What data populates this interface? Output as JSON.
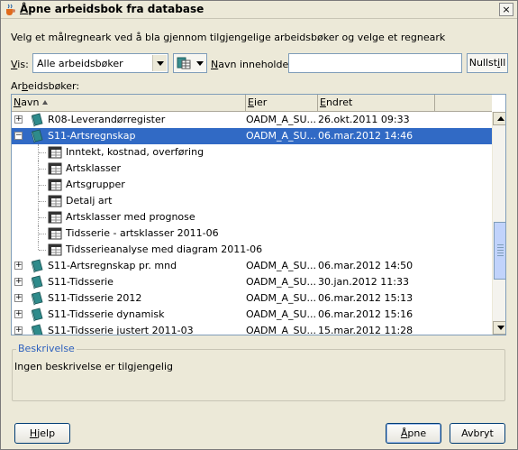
{
  "window": {
    "title_prefix": "Å",
    "title_rest": "pne arbeidsbok fra database",
    "close_label": "×"
  },
  "instruction": "Velg et målregneark ved å bla gjennom tilgjengelige arbeidsbøker og velge et regneark",
  "filter": {
    "vis_prefix": "V",
    "vis_rest": "is:",
    "vis_value": "Alle arbeidsbøker",
    "name_prefix": "N",
    "name_rest": "avn inneholder:",
    "name_value": "",
    "reset_a": "Nullst",
    "reset_u": "i",
    "reset_b": "ll"
  },
  "workbooks_label_a": "Ar",
  "workbooks_label_u": "b",
  "workbooks_label_b": "eidsbøker:",
  "columns": {
    "name_prefix": "N",
    "name_rest": "avn",
    "owner_prefix": "E",
    "owner_rest": "ier",
    "changed_prefix": "E",
    "changed_rest": "ndret"
  },
  "rows": [
    {
      "kind": "workbook",
      "expander": "+",
      "name": "R08-Leverandørregister",
      "owner": "OADM_A_SU...",
      "changed": "26.okt.2011 09:33"
    },
    {
      "kind": "workbook",
      "expander": "−",
      "name": "S11-Artsregnskap",
      "owner": "OADM_A_SU...",
      "changed": "06.mar.2012 14:46",
      "selected": true
    },
    {
      "kind": "sheet",
      "name": "Inntekt, kostnad, overføring"
    },
    {
      "kind": "sheet",
      "name": "Artsklasser"
    },
    {
      "kind": "sheet",
      "name": "Artsgrupper"
    },
    {
      "kind": "sheet",
      "name": "Detalj art"
    },
    {
      "kind": "sheet",
      "name": "Artsklasser med prognose"
    },
    {
      "kind": "sheet",
      "name": "Tidsserie - artsklasser 2011-06"
    },
    {
      "kind": "sheet",
      "name": "Tidsserieanalyse med diagram 2011-06"
    },
    {
      "kind": "workbook",
      "expander": "+",
      "name": "S11-Artsregnskap pr. mnd",
      "owner": "OADM_A_SU...",
      "changed": "06.mar.2012 14:50"
    },
    {
      "kind": "workbook",
      "expander": "+",
      "name": "S11-Tidsserie",
      "owner": "OADM_A_SU...",
      "changed": "30.jan.2012 11:33"
    },
    {
      "kind": "workbook",
      "expander": "+",
      "name": "S11-Tidsserie 2012",
      "owner": "OADM_A_SU...",
      "changed": "06.mar.2012 15:13"
    },
    {
      "kind": "workbook",
      "expander": "+",
      "name": "S11-Tidsserie dynamisk",
      "owner": "OADM_A_SU...",
      "changed": "06.mar.2012 15:16"
    },
    {
      "kind": "workbook",
      "expander": "+",
      "name": "S11-Tidsserie justert 2011-03",
      "owner": "OADM_A_SU...",
      "changed": "15.mar.2012 11:28"
    }
  ],
  "description": {
    "legend": "Beskrivelse",
    "text": "Ingen beskrivelse er tilgjengelig"
  },
  "buttons": {
    "help_prefix": "H",
    "help_rest": "jelp",
    "open_prefix": "Å",
    "open_rest": "pne",
    "cancel": "Avbryt"
  },
  "colors": {
    "selection": "#316ac5",
    "dialog_bg": "#ece9d8",
    "legend_blue": "#2c5fbd",
    "workbook_teal": "#2e8b8b"
  },
  "icons": {
    "app": "java-coffee-icon",
    "workbook": "workbook-book-icon",
    "sheet": "worksheet-grid-icon",
    "view": "view-options-icon"
  }
}
